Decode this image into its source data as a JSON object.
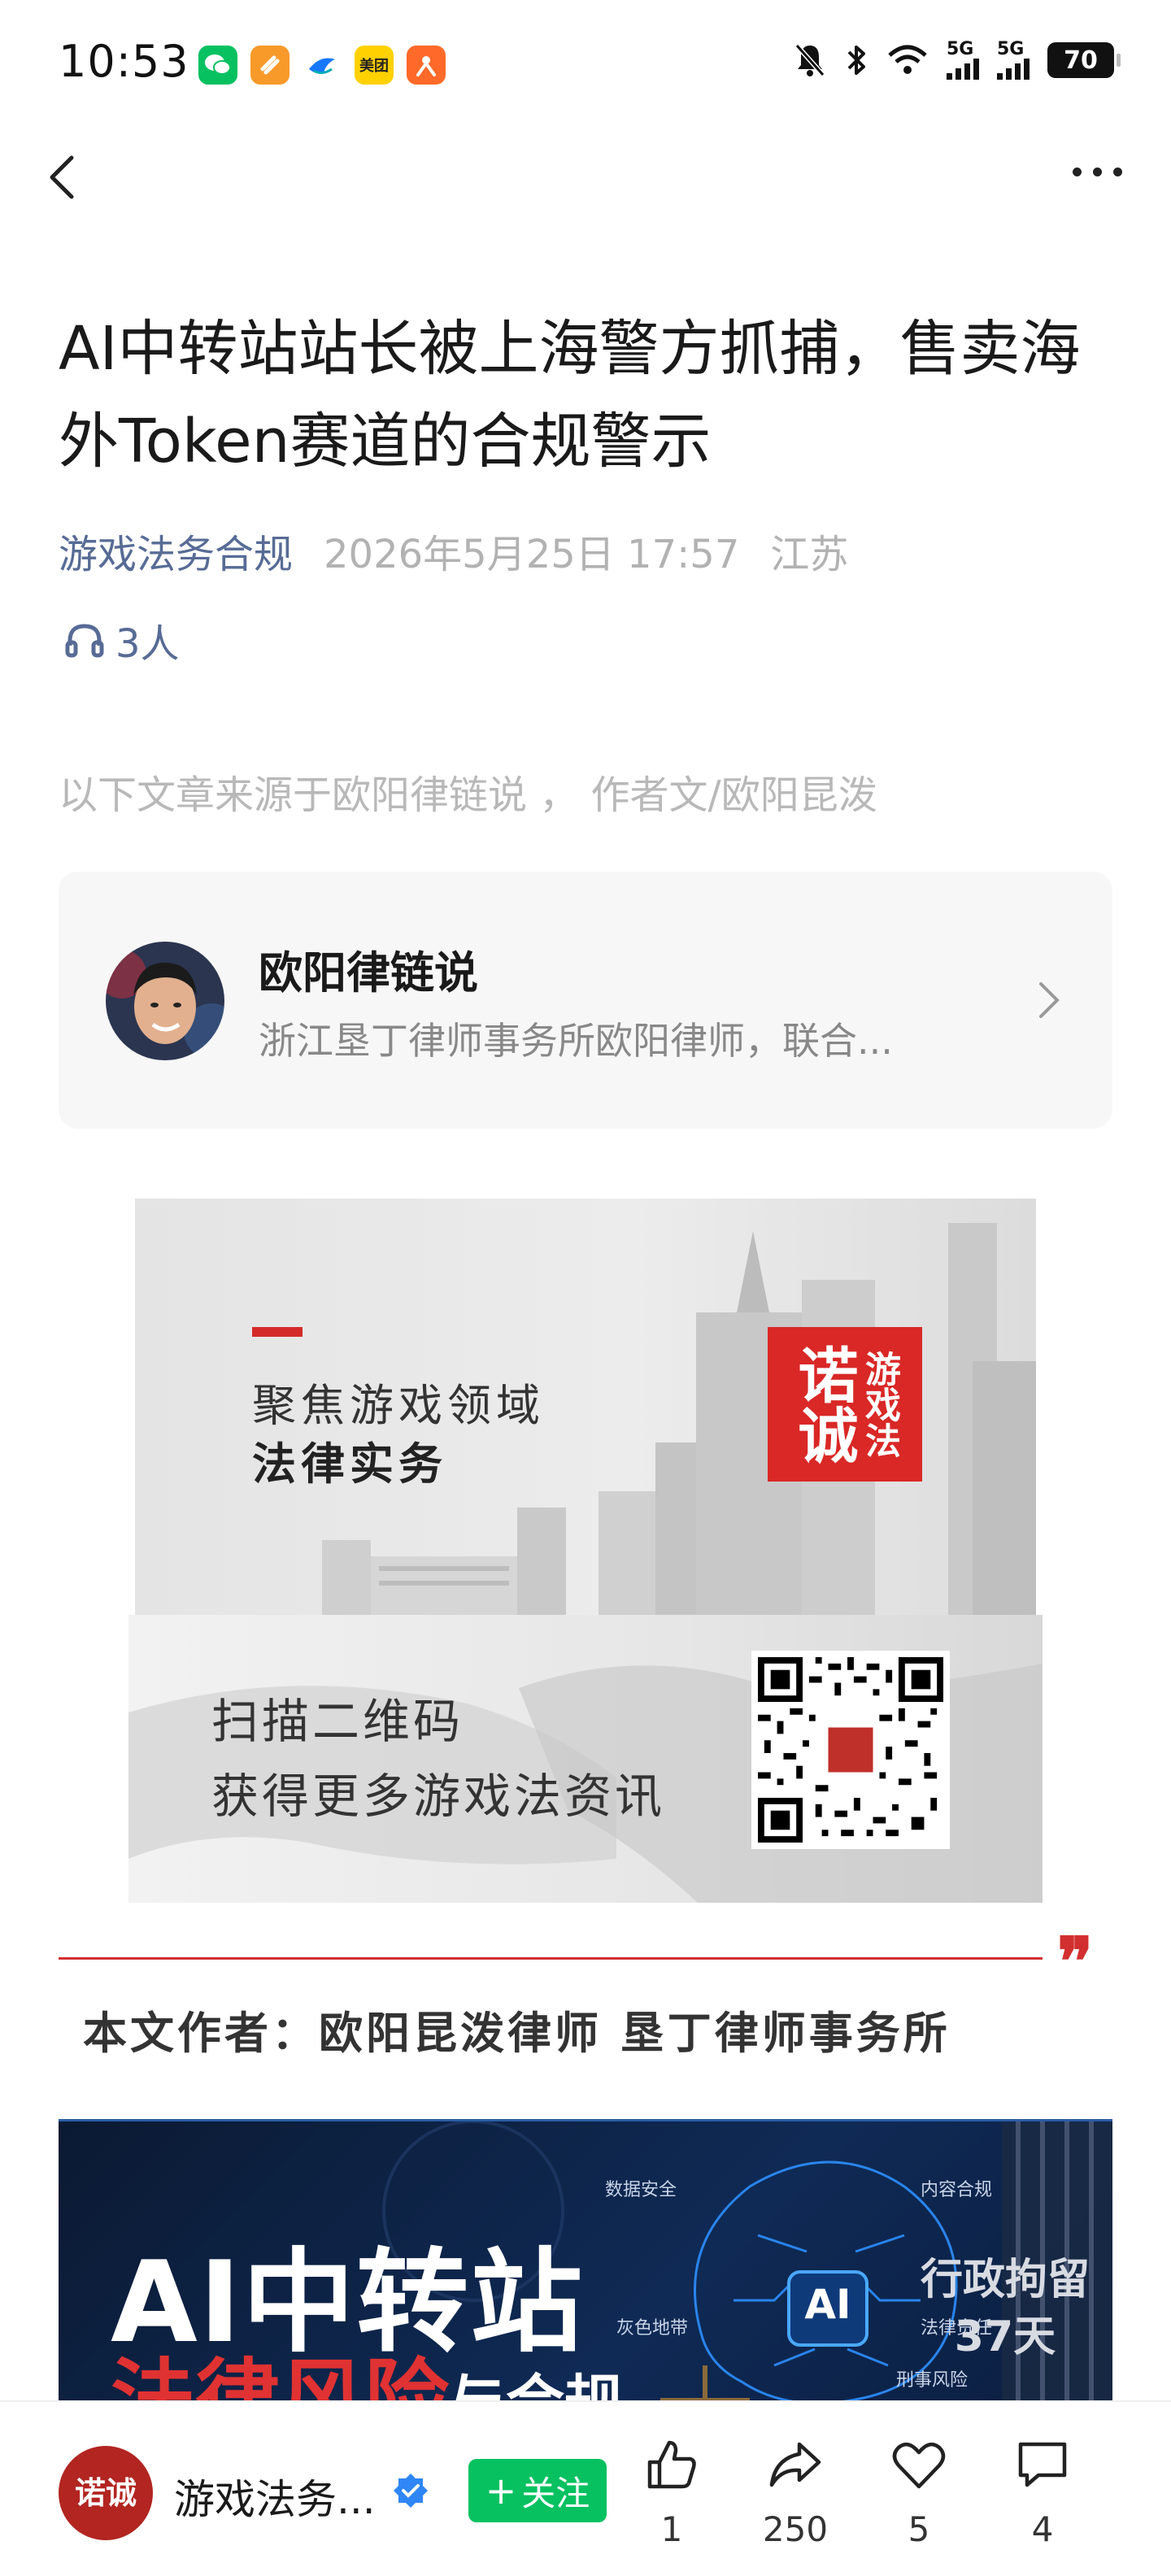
{
  "status_bar": {
    "time": "10:53",
    "app_icons": [
      {
        "name": "wechat-icon",
        "color": "#07c160",
        "glyph": "✆"
      },
      {
        "name": "app-orange-icon",
        "color": "#f79a2a",
        "glyph": "∞"
      },
      {
        "name": "bird-app-icon",
        "color": "#ffffff",
        "glyph": "◣"
      },
      {
        "name": "meituan-icon",
        "color": "#ffd100",
        "glyph": "美团"
      },
      {
        "name": "taobao-icon",
        "color": "#ff6a2a",
        "glyph": "✿"
      }
    ],
    "network_1": "5G",
    "network_2": "5G",
    "battery": "70"
  },
  "article": {
    "title": "AI中转站站长被上海警方抓捕，售卖海外Token赛道的合规警示",
    "author": "游戏法务合规",
    "date": "2026年5月25日 17:57",
    "location": "江苏",
    "listeners": "3人",
    "source_note": "以下文章来源于欧阳律链说 ， 作者文/欧阳昆泼"
  },
  "profile_card": {
    "name": "欧阳律链说",
    "description": "浙江垦丁律师事务所欧阳律师，联合..."
  },
  "banner": {
    "line1": "聚焦游戏领域",
    "line2": "法律实务",
    "seal_big": "诺诚",
    "seal_small": "游戏法"
  },
  "qr_banner": {
    "line1": "扫描二维码",
    "line2": "获得更多游戏法资讯"
  },
  "author_section": {
    "quote_mark": "❞",
    "text": "本文作者：欧阳昆泼律师 垦丁律师事务所"
  },
  "hero_image": {
    "title": "AI中转站",
    "subtitle_red": "法律风险",
    "subtitle_white": "与合规",
    "brain_label": "AI",
    "tags": [
      "数据安全",
      "内容合规",
      "灰色地带",
      "法律责任",
      "刑事风险"
    ],
    "right_line1": "行政拘留",
    "right_line2": "37天"
  },
  "bottom_bar": {
    "account_name": "游戏法务...",
    "avatar_text": "诺诚",
    "follow_label": "关注",
    "like_count": "1",
    "share_count": "250",
    "favorite_count": "5",
    "comment_count": "4"
  }
}
